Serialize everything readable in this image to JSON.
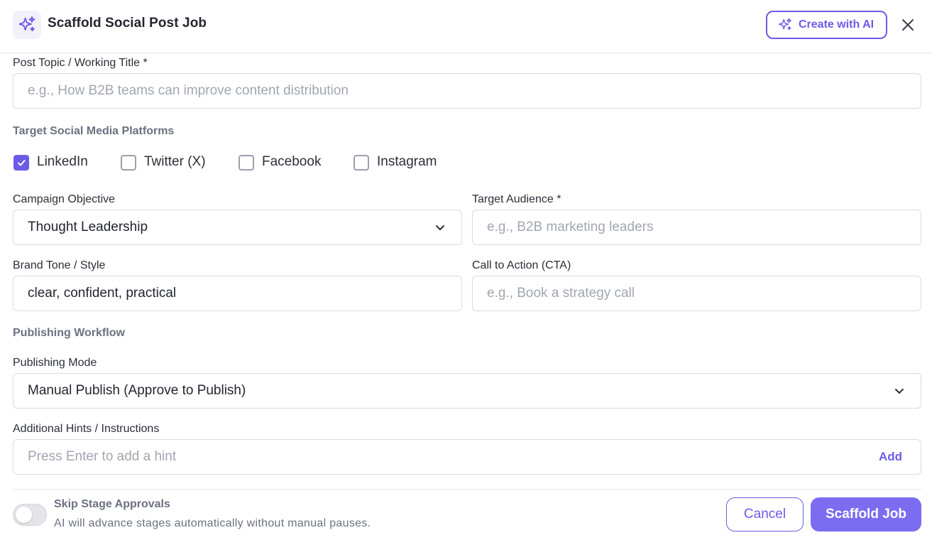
{
  "header": {
    "title": "Scaffold Social Post Job",
    "logo_icon": "sparkles-icon",
    "create_ai_label": "Create with AI",
    "close_icon": "close-icon"
  },
  "colors": {
    "accent": "#6b5ce7",
    "primary_button": "#7c6cf0",
    "border": "#d9dbe2"
  },
  "post_topic": {
    "label": "Post Topic / Working Title *",
    "placeholder": "e.g., How B2B teams can improve content distribution",
    "value": ""
  },
  "platforms": {
    "label": "Target Social Media Platforms",
    "items": [
      {
        "label": "LinkedIn",
        "checked": true
      },
      {
        "label": "Twitter (X)",
        "checked": false
      },
      {
        "label": "Facebook",
        "checked": false
      },
      {
        "label": "Instagram",
        "checked": false
      }
    ]
  },
  "campaign_objective": {
    "label": "Campaign Objective",
    "value": "Thought Leadership"
  },
  "target_audience": {
    "label": "Target Audience *",
    "placeholder": "e.g., B2B marketing leaders",
    "value": ""
  },
  "brand_tone": {
    "label": "Brand Tone / Style",
    "value": "clear, confident, practical"
  },
  "cta": {
    "label": "Call to Action (CTA)",
    "placeholder": "e.g., Book a strategy call",
    "value": ""
  },
  "publishing_workflow": {
    "label": "Publishing Workflow",
    "mode_label": "Publishing Mode",
    "mode_value": "Manual Publish (Approve to Publish)"
  },
  "hints": {
    "label": "Additional Hints / Instructions",
    "placeholder": "Press Enter to add a hint",
    "add_label": "Add"
  },
  "footer": {
    "skip_title": "Skip Stage Approvals",
    "skip_desc": "AI will advance stages automatically without manual pauses.",
    "skip_enabled": false,
    "cancel_label": "Cancel",
    "submit_label": "Scaffold Job"
  }
}
